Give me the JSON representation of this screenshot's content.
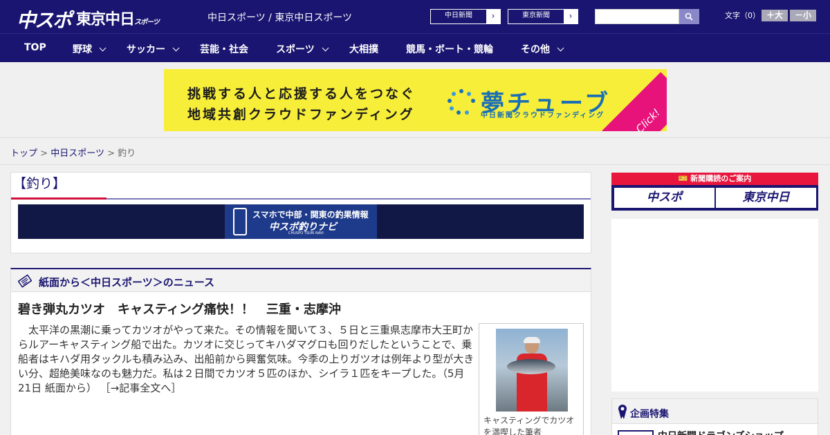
{
  "header": {
    "logo_chuspo": "中スポ",
    "logo_tokyo": "東京中日",
    "logo_tokyo_small": "スポーツ",
    "site_links": "中日スポーツ / 東京中日スポーツ",
    "paper_buttons": [
      "中日新聞",
      "東京新聞"
    ],
    "search_placeholder": "",
    "font_label": "文字（0）",
    "font_bigger": "＋大",
    "font_smaller": "－小"
  },
  "nav": {
    "items": [
      {
        "label": "TOP"
      },
      {
        "label": "野球"
      },
      {
        "label": "サッカー"
      },
      {
        "label": "芸能・社会"
      },
      {
        "label": "スポーツ"
      },
      {
        "label": "大相撲"
      },
      {
        "label": "競馬・ボート・競輪"
      },
      {
        "label": "その他"
      }
    ]
  },
  "banner": {
    "line1": "挑戦する人と応援する人をつなぐ",
    "line2": "地域共創クラウドファンディング",
    "logo": "夢チューブ",
    "sub": "中日新聞クラウドファンディング",
    "click": "Click!"
  },
  "breadcrumb": {
    "home": "トップ",
    "section": "中日スポーツ",
    "current": "釣り",
    "separator": ">"
  },
  "category": {
    "title": "【釣り】",
    "navi_line1": "スマホで中部・関東の釣果情報",
    "navi_line2": "中スポ釣りナビ",
    "navi_line3": "CHUSPO TSURI NAVI"
  },
  "news": {
    "heading": "紙面から＜中日スポーツ＞のニュース",
    "article_title": "碧き弾丸カツオ　キャスティング痛快！！　三重・志摩沖",
    "article_body": "太平洋の黒潮に乗ってカツオがやって来た。その情報を聞いて３、５日と三重県志摩市大王町からルアーキャスティング船で出た。カツオに交じってキハダマグロも回りだしたということで、乗船者はキハダ用タックルも積み込み、出船前から興奮気味。今季の上りガツオは例年より型が大きい分、超絶美味なのも魅力だ。私は２日間でカツオ５匹のほか、シイラ１匹をキープした。（5月21日 紙面から）",
    "article_more": "［→記事全文へ］",
    "photo_caption_1": "キャスティングでカツオ",
    "photo_caption_2": "を満喫した筆者"
  },
  "sidebar": {
    "subscription_head": "新聞購読のご案内",
    "sub_chuspo": "中スポ",
    "sub_tokyo": "東京中日",
    "feature_title": "企画特集",
    "feature_item": "中日新聞ドラゴンズショップ"
  },
  "colors": {
    "navy": "#1a1570",
    "red": "#e8163d",
    "banner_yellow": "#f7ee3a"
  }
}
